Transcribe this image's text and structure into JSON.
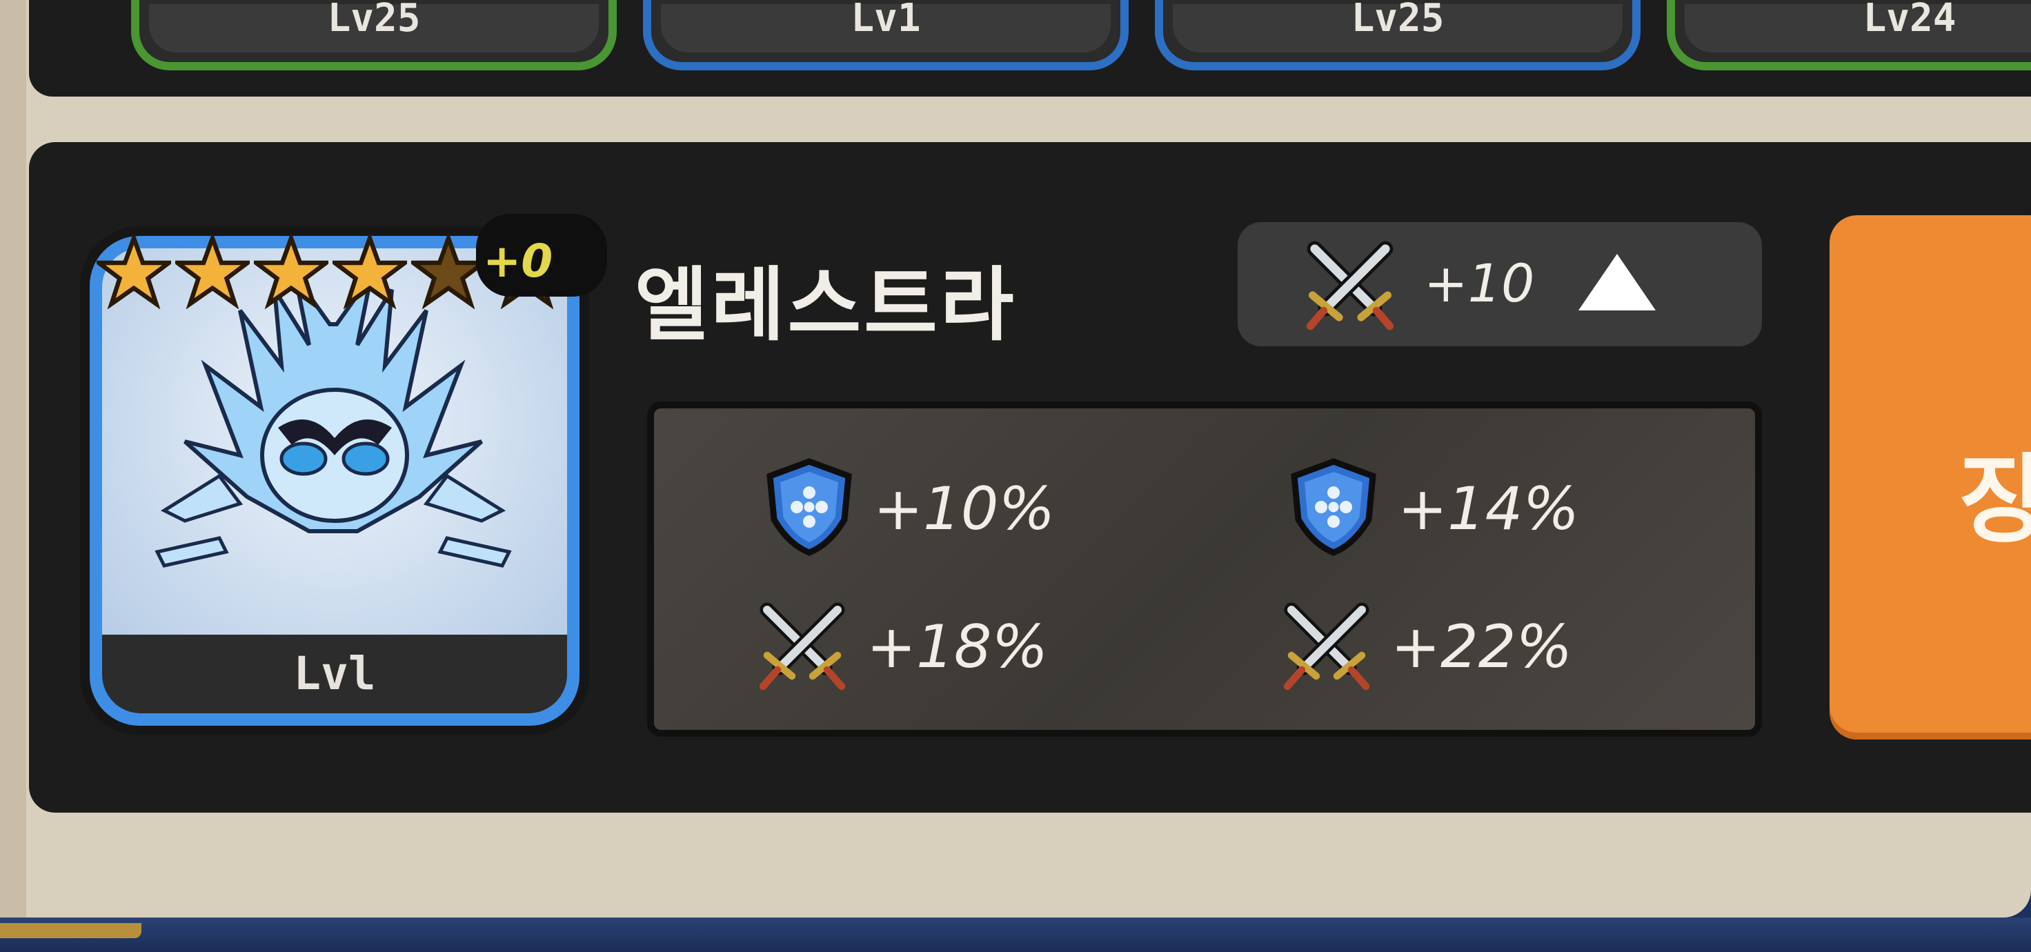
{
  "top_cards": [
    {
      "level": "Lv25",
      "border_color": "#4a9632"
    },
    {
      "level": "Lv1",
      "border_color": "#2d6fc2"
    },
    {
      "level": "Lv25",
      "border_color": "#2d6fc2"
    },
    {
      "level": "Lv24",
      "border_color": "#4a9632"
    }
  ],
  "hero": {
    "name": "엘레스트라",
    "level": "Lvl",
    "star_rating": {
      "filled": 4,
      "max": 6
    },
    "plus": "+0",
    "portrait_icon": "ice-spirit-icon",
    "attack_bonus": "+10",
    "attack_icon": "crossed-swords-icon",
    "upgrade_icon": "up-triangle-icon"
  },
  "stats": [
    {
      "icon": "shield-icon",
      "value": "+10%"
    },
    {
      "icon": "shield-icon",
      "value": "+14%"
    },
    {
      "icon": "crossed-swords-icon",
      "value": "+18%"
    },
    {
      "icon": "crossed-swords-icon",
      "value": "+22%"
    }
  ],
  "equip_button": {
    "label": "장"
  },
  "colors": {
    "frame": "#d9cfbd",
    "panel": "#1c1c1c",
    "rare_blue": "#3f8ee6",
    "common_green": "#4a9632",
    "star_gold": "#f3b23a",
    "button_orange": "#ee8a32"
  }
}
